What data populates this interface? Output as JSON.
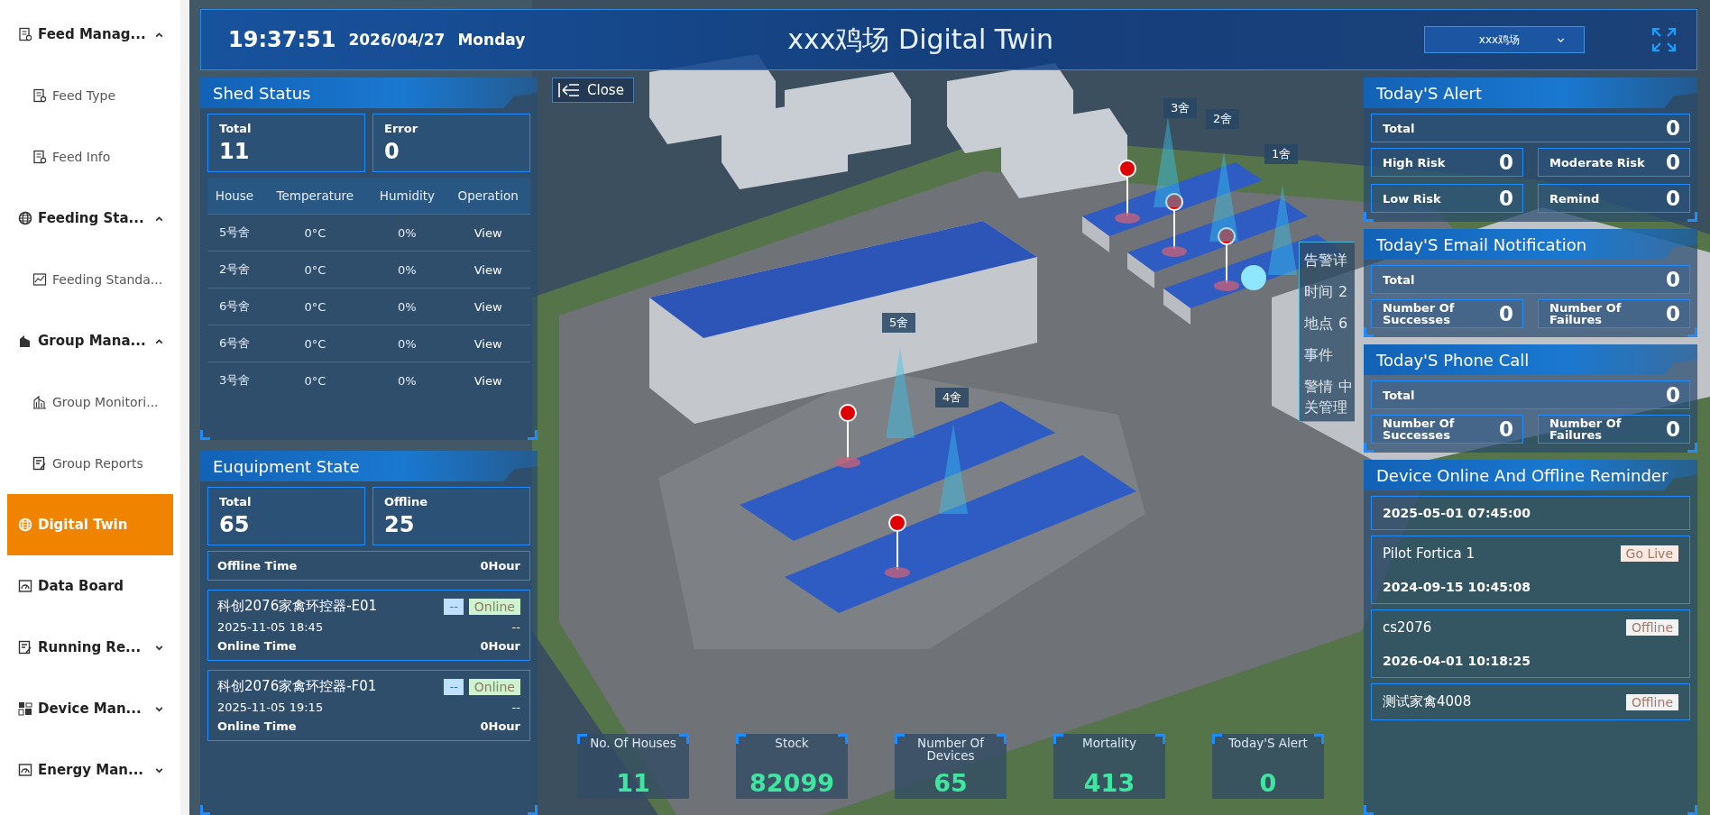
{
  "sidebar": {
    "items": [
      {
        "label": "Feed Manag...",
        "expanded": true,
        "selected": false,
        "children": [
          {
            "label": "Feed Type",
            "selected": false
          },
          {
            "label": "Feed Info",
            "selected": false
          }
        ]
      },
      {
        "label": "Feeding Sta...",
        "expanded": true,
        "selected": false,
        "children": [
          {
            "label": "Feeding Standa...",
            "selected": false
          }
        ]
      },
      {
        "label": "Group Mana...",
        "expanded": true,
        "selected": false,
        "children": [
          {
            "label": "Group Monitori...",
            "selected": false
          },
          {
            "label": "Group Reports",
            "selected": false
          }
        ]
      },
      {
        "label": "Digital Twin",
        "selected": true
      },
      {
        "label": "Data Board",
        "selected": false
      },
      {
        "label": "Running Re...",
        "expanded": false,
        "selected": false
      },
      {
        "label": "Device Man...",
        "expanded": false,
        "selected": false
      },
      {
        "label": "Energy Man...",
        "expanded": false,
        "selected": false
      }
    ]
  },
  "header": {
    "time": "19:37:51",
    "date": "2026/04/27",
    "weekday": "Monday",
    "title": "xxx鸡场 Digital Twin",
    "farm_select": "xxx鸡场"
  },
  "close_button": "Close",
  "shed_status": {
    "title": "Shed Status",
    "stats": [
      {
        "label": "Total",
        "value": "11"
      },
      {
        "label": "Error",
        "value": "0"
      }
    ],
    "table": {
      "columns": [
        "House",
        "Temperature",
        "Humidity",
        "Operation"
      ],
      "rows": [
        [
          "5号舍",
          "0°C",
          "0%",
          "View"
        ],
        [
          "2号舍",
          "0°C",
          "0%",
          "View"
        ],
        [
          "6号舍",
          "0°C",
          "0%",
          "View"
        ],
        [
          "6号舍",
          "0°C",
          "0%",
          "View"
        ],
        [
          "3号舍",
          "0°C",
          "0%",
          "View"
        ]
      ]
    }
  },
  "equipment_state": {
    "title": "Euquipment State",
    "stats": [
      {
        "label": "Total",
        "value": "65"
      },
      {
        "label": "Offline",
        "value": "25"
      }
    ],
    "devices": [
      {
        "time_label": "Offline Time",
        "duration": "0Hour"
      },
      {
        "name": "科创2076家禽环控器-E01",
        "tag": "--",
        "status": "Online",
        "color": "#cdf3d0",
        "date": "2025-11-05 18:45",
        "value": "--",
        "time_label": "Online Time",
        "duration": "0Hour"
      },
      {
        "name": "科创2076家禽环控器-F01",
        "tag": "--",
        "status": "Online",
        "color": "#cdf3d0",
        "date": "2025-11-05 19:15",
        "value": "--",
        "time_label": "Online Time",
        "duration": "0Hour"
      }
    ]
  },
  "scene_labels": [
    "3舍",
    "2舍",
    "1舍",
    "5舍",
    "4舍"
  ],
  "alert_popup": {
    "title": "告警详",
    "rows": [
      {
        "label": "时间",
        "value": "2"
      },
      {
        "label": "地点",
        "value": "6"
      },
      {
        "label": "事件"
      },
      {
        "label": "警情",
        "value": "中"
      }
    ],
    "note": "关管理"
  },
  "bottom_stats": [
    {
      "label": "No. Of Houses",
      "value": "11"
    },
    {
      "label": "Stock",
      "value": "82099"
    },
    {
      "label": "Number Of Devices",
      "value": "65"
    },
    {
      "label": "Mortality",
      "value": "413"
    },
    {
      "label": "Today'S Alert",
      "value": "0"
    }
  ],
  "todays_alert": {
    "title": "Today'S Alert",
    "total": {
      "label": "Total",
      "value": "0"
    },
    "items": [
      {
        "label": "High Risk",
        "value": "0"
      },
      {
        "label": "Moderate Risk",
        "value": "0"
      },
      {
        "label": "Low Risk",
        "value": "0"
      },
      {
        "label": "Remind",
        "value": "0"
      }
    ]
  },
  "email_notification": {
    "title": "Today'S Email Notification",
    "total": {
      "label": "Total",
      "value": "0"
    },
    "items": [
      {
        "label": "Number Of Successes",
        "value": "0"
      },
      {
        "label": "Number Of Failures",
        "value": "0"
      }
    ]
  },
  "phone_call": {
    "title": "Today'S Phone Call",
    "total": {
      "label": "Total",
      "value": "0"
    },
    "items": [
      {
        "label": "Number Of Successes",
        "value": "0"
      },
      {
        "label": "Number Of Failures",
        "value": "0"
      }
    ]
  },
  "device_reminder": {
    "title": "Device Online And Offline Reminder",
    "items": [
      {
        "date": "2025-05-01 07:45:00"
      },
      {
        "name": "Pilot Fortica 1",
        "status": "Go Live",
        "color": "#fbe9e4",
        "date": "2024-09-15 10:45:08"
      },
      {
        "name": "cs2076",
        "status": "Offline",
        "color": "#f2f2f2",
        "date": "2026-04-01 10:18:25"
      },
      {
        "name": "测试家禽4008",
        "status": "Offline",
        "color": "#f2f2f2"
      }
    ]
  }
}
